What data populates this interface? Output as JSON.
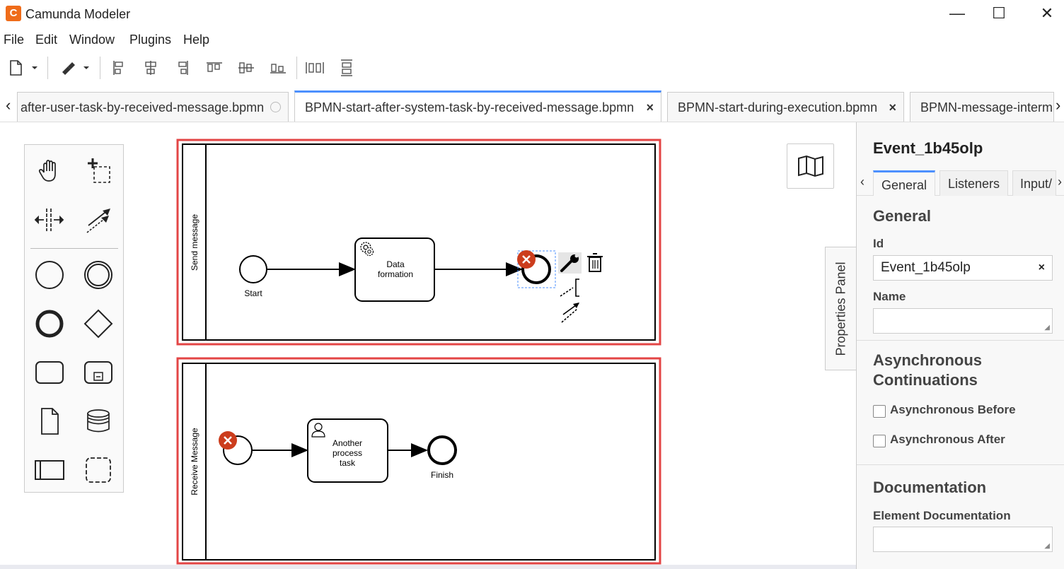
{
  "window": {
    "title": "Camunda Modeler",
    "app_icon_glyph": "C",
    "controls": [
      "—",
      "☐",
      "✕"
    ]
  },
  "menu": {
    "items": [
      "File",
      "Edit",
      "Window",
      "Plugins",
      "Help"
    ]
  },
  "tabs": [
    {
      "label": "after-user-task-by-received-message.bpmn",
      "active": false,
      "close": "dot"
    },
    {
      "label": "BPMN-start-after-system-task-by-received-message.bpmn",
      "active": true,
      "close": "×"
    },
    {
      "label": "BPMN-start-during-execution.bpmn",
      "active": false,
      "close": "×"
    },
    {
      "label": "BPMN-message-interm",
      "active": false,
      "close": ""
    }
  ],
  "tab_scroll": {
    "left": "‹",
    "right": "›"
  },
  "diagram": {
    "pool1": {
      "label": "Send message"
    },
    "pool2": {
      "label": "Receive Message"
    },
    "start_label": "Start",
    "task1_label": [
      "Data",
      "formation"
    ],
    "task2_label": [
      "Another",
      "process",
      "task"
    ],
    "finish_label": "Finish"
  },
  "properties_panel": {
    "toggle_label": "Properties Panel",
    "title": "Event_1b45olp",
    "tabs": [
      "General",
      "Listeners",
      "Input/"
    ],
    "tab_prev": "‹",
    "tab_next": "›",
    "general": {
      "heading": "General",
      "id_label": "Id",
      "id_value": "Event_1b45olp",
      "clear": "×",
      "name_label": "Name",
      "name_value": ""
    },
    "async": {
      "heading_line1": "Asynchronous",
      "heading_line2": "Continuations",
      "before": "Asynchronous Before",
      "after": "Asynchronous After"
    },
    "documentation": {
      "heading": "Documentation",
      "element_label": "Element Documentation",
      "value": ""
    }
  },
  "colors": {
    "accent": "#4d90fe",
    "error": "#cc3d1d",
    "highlight": "#e34545",
    "app_icon": "#ef6c1a"
  }
}
